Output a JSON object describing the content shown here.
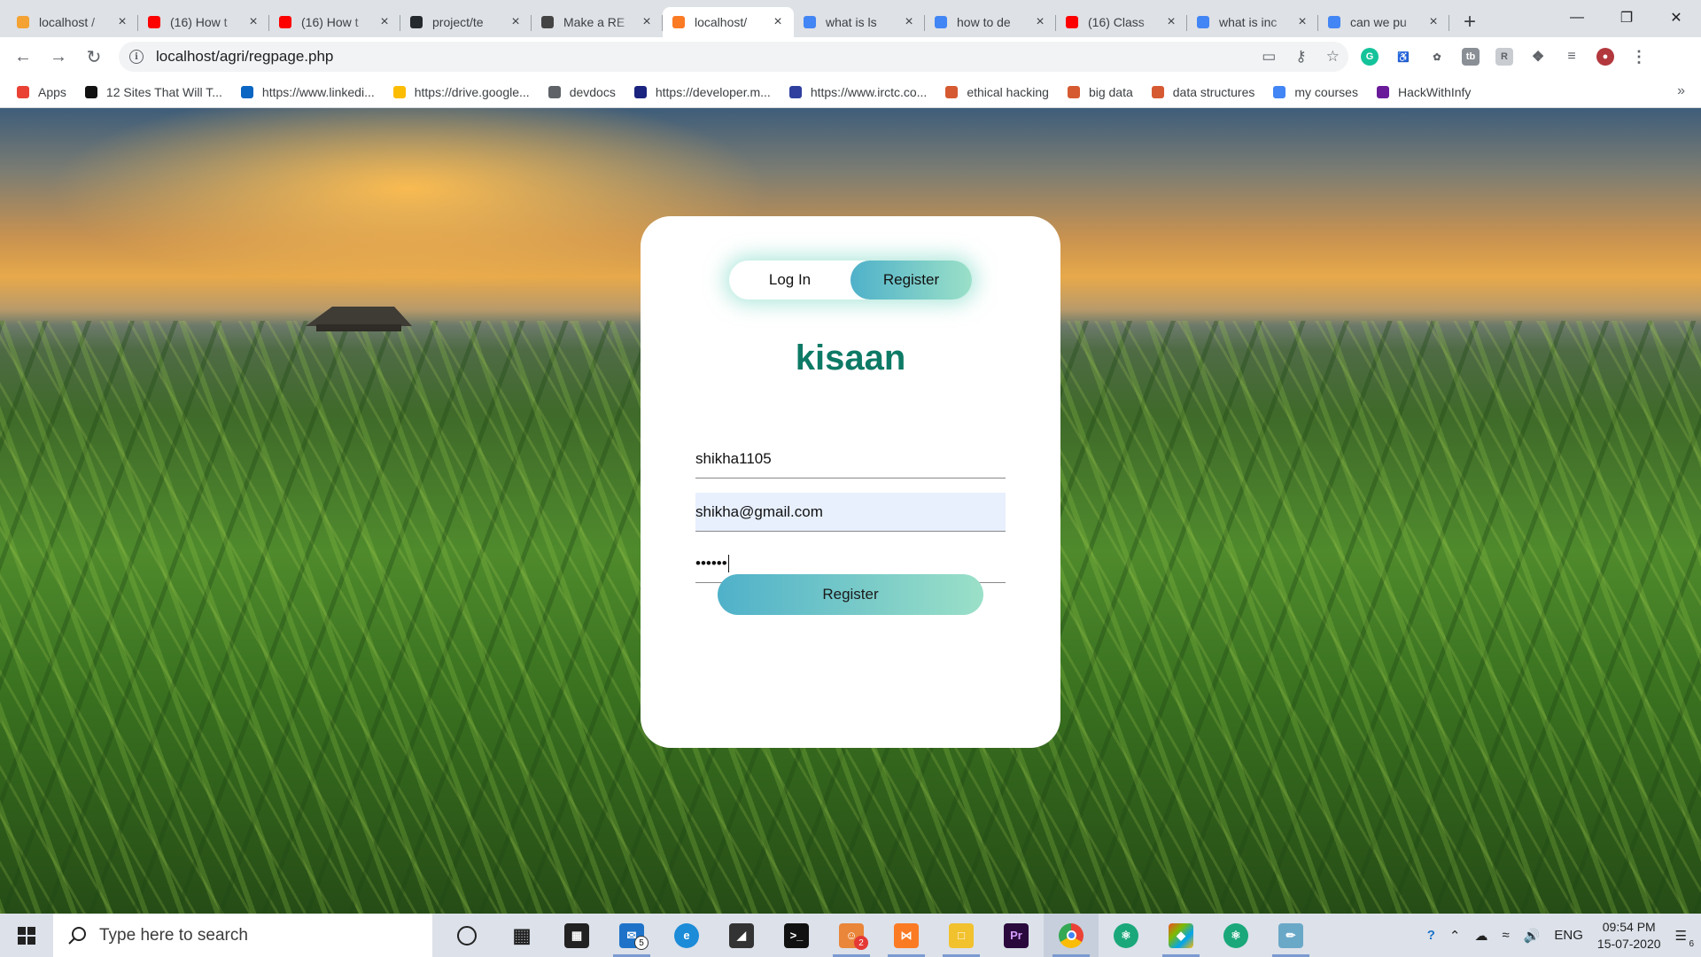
{
  "browser": {
    "tabs": [
      {
        "title": "localhost /",
        "favicon": "pma-icon",
        "color": "#f3a233"
      },
      {
        "title": "(16) How t",
        "favicon": "youtube-icon",
        "color": "#ff0000"
      },
      {
        "title": "(16) How t",
        "favicon": "youtube-icon",
        "color": "#ff0000"
      },
      {
        "title": "project/te",
        "favicon": "github-icon",
        "color": "#24292e"
      },
      {
        "title": "Make a RE",
        "favicon": "document-icon",
        "color": "#444444"
      },
      {
        "title": "localhost/",
        "favicon": "xampp-icon",
        "color": "#fb7a24",
        "active": true
      },
      {
        "title": "what is ls",
        "favicon": "google-icon",
        "color": "#4285f4"
      },
      {
        "title": "how to de",
        "favicon": "google-icon",
        "color": "#4285f4"
      },
      {
        "title": "(16) Class",
        "favicon": "youtube-icon",
        "color": "#ff0000"
      },
      {
        "title": "what is inc",
        "favicon": "google-icon",
        "color": "#4285f4"
      },
      {
        "title": "can we pu",
        "favicon": "google-icon",
        "color": "#4285f4"
      }
    ],
    "new_tab": "+",
    "url": "localhost/agri/regpage.php",
    "bookmarks": [
      {
        "label": "Apps",
        "icon": "apps-grid-icon"
      },
      {
        "label": "12 Sites That Will T...",
        "icon": "e-icon"
      },
      {
        "label": "https://www.linkedi...",
        "icon": "linkedin-icon"
      },
      {
        "label": "https://drive.google...",
        "icon": "drive-icon"
      },
      {
        "label": "devdocs",
        "icon": "devdocs-icon"
      },
      {
        "label": "https://developer.m...",
        "icon": "developer-icon"
      },
      {
        "label": "https://www.irctc.co...",
        "icon": "irctc-icon"
      },
      {
        "label": "ethical hacking",
        "icon": "bookmark-icon"
      },
      {
        "label": "big data",
        "icon": "bookmark-icon"
      },
      {
        "label": "data structures",
        "icon": "bookmark-icon"
      },
      {
        "label": "my courses",
        "icon": "google-icon"
      },
      {
        "label": "HackWithInfy",
        "icon": "hackwithinfy-icon"
      }
    ],
    "more_bookmarks": "»"
  },
  "form": {
    "toggle_login": "Log In",
    "toggle_register": "Register",
    "brand": "kisaan",
    "username": "shikha1105",
    "email": "shikha@gmail.com",
    "password_mask": "••••••",
    "submit": "Register"
  },
  "taskbar": {
    "search_placeholder": "Type here to search",
    "mail_badge": "5",
    "app_badge": "2",
    "language": "ENG",
    "time": "09:54 PM",
    "date": "15-07-2020",
    "notifications": "6"
  },
  "colors": {
    "accent_teal": "#0e7a66",
    "button_gradient_start": "#4fb1c9",
    "button_gradient_end": "#9be0c8"
  }
}
